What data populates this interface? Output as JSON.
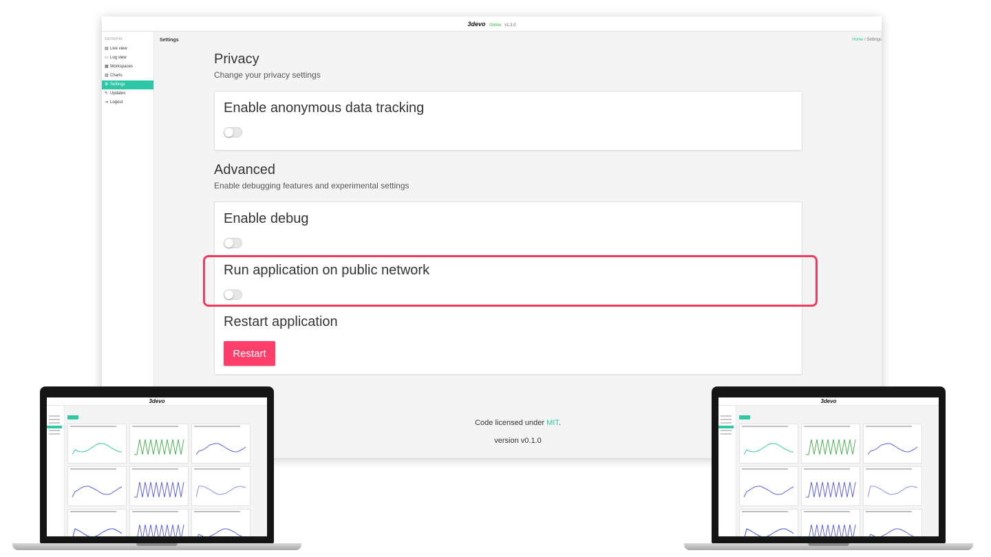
{
  "header": {
    "brand": "3devo",
    "status": "Online",
    "version": "v1.3.0"
  },
  "sidebar": {
    "heading": "GENERAL",
    "items": [
      {
        "label": "Live view",
        "icon": "dashboard-icon",
        "glyph": "▤"
      },
      {
        "label": "Log view",
        "icon": "laptop-icon",
        "glyph": "▭"
      },
      {
        "label": "Workspaces",
        "icon": "workspaces-icon",
        "glyph": "▦"
      },
      {
        "label": "Charts",
        "icon": "bar-chart-icon",
        "glyph": "▥"
      },
      {
        "label": "Settings",
        "icon": "gear-icon",
        "glyph": "⚙",
        "active": true
      },
      {
        "label": "Updates",
        "icon": "wrench-icon",
        "glyph": "✎"
      },
      {
        "label": "Logout",
        "icon": "logout-icon",
        "glyph": "⇥"
      }
    ]
  },
  "page": {
    "title": "Settings",
    "breadcrumb": {
      "home": "Home",
      "separator": "/",
      "current": "Settings"
    }
  },
  "privacy": {
    "title": "Privacy",
    "subtitle": "Change your privacy settings",
    "options": [
      {
        "label": "Enable anonymous data tracking",
        "enabled": false
      }
    ]
  },
  "advanced": {
    "title": "Advanced",
    "subtitle": "Enable debugging features and experimental settings",
    "options": [
      {
        "label": "Enable debug",
        "enabled": false
      },
      {
        "label": "Run application on public network",
        "enabled": false
      }
    ],
    "restart": {
      "label": "Restart application",
      "button": "Restart"
    }
  },
  "footer": {
    "license_prefix": "Code licensed under ",
    "license_link": "MIT",
    "license_suffix": ".",
    "version": "version v0.1.0"
  },
  "laptop_brand": "3devo",
  "colors": {
    "accent": "#2ec6a4",
    "danger": "#ff3e69",
    "highlight": "#f03a5f",
    "background": "#f4f4f4"
  }
}
